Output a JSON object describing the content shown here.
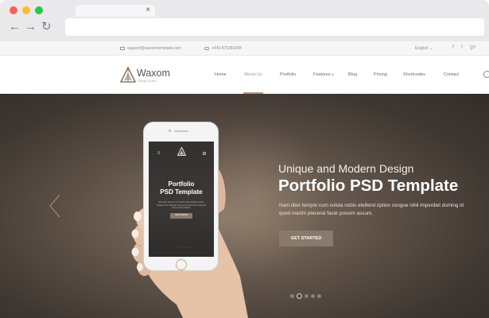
{
  "browser": {
    "tab_close": "×",
    "back": "←",
    "forward": "→",
    "reload": "↻"
  },
  "topbar": {
    "email": "support@waxomtemplate.com",
    "phone": "+440 875369208",
    "language": "English",
    "language_caret": "⌄",
    "social_icons": [
      "facebook-icon",
      "twitter-icon",
      "google-plus-icon"
    ],
    "social_glyphs": [
      "f",
      "t",
      "g+"
    ]
  },
  "logo": {
    "name": "Waxom",
    "tagline": "Design Studio"
  },
  "nav": {
    "items": [
      "Home",
      "About Us",
      "Portfolio",
      "Features",
      "Blog",
      "Pricing",
      "Shortcodes",
      "Contact"
    ],
    "active": "About Us",
    "features_caret": "▾"
  },
  "hero": {
    "subhead": "Unique and Modern Design",
    "headline": "Portfolio PSD Template",
    "paragraph": "Nam liber tempor cum soluta nobis eleifend option congue nihil imperdiet doming id quod mazim placerat facer possim assum.",
    "cta": "GET STARTED",
    "slides_total": 5,
    "slide_active": 2
  },
  "phone_screen": {
    "menu_glyph": "≡",
    "title_line1": "Portfolio",
    "title_line2": "PSD Template",
    "text": "Nam liber tempor cum soluta nobis eleifend option congue nihil imperdiet doming id quod mazim placerat facer possim assum.",
    "cta": "GET STARTED",
    "dots": "• ○ • • •"
  },
  "colors": {
    "accent": "#8a7a6c",
    "nav_active": "#b09a8a",
    "hero_bg": "#5f5248"
  }
}
